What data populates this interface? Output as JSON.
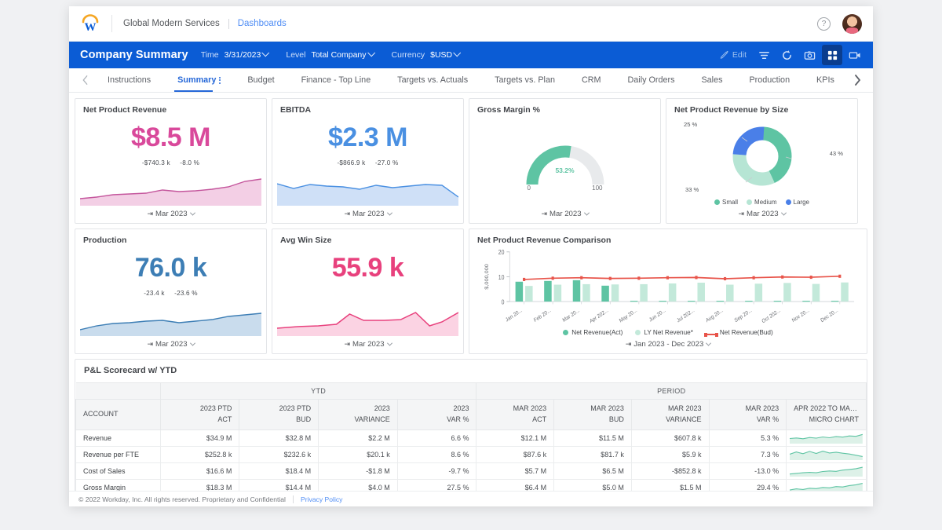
{
  "header": {
    "company": "Global Modern Services",
    "section": "Dashboards",
    "help_icon": "question-mark-icon",
    "logo": "workday-logo"
  },
  "toolbar": {
    "title": "Company Summary",
    "filters": [
      {
        "label": "Time",
        "value": "3/31/2023"
      },
      {
        "label": "Level",
        "value": "Total Company"
      },
      {
        "label": "Currency",
        "value": "$USD"
      }
    ],
    "edit_label": "Edit",
    "icons": [
      "pencil-icon",
      "filter-icon",
      "refresh-icon",
      "camera-icon",
      "grid-icon",
      "presentation-icon"
    ]
  },
  "tabs": [
    {
      "label": "Instructions",
      "active": false
    },
    {
      "label": "Summary",
      "active": true
    },
    {
      "label": "Budget",
      "active": false
    },
    {
      "label": "Finance - Top Line",
      "active": false
    },
    {
      "label": "Targets vs. Actuals",
      "active": false
    },
    {
      "label": "Targets vs. Plan",
      "active": false
    },
    {
      "label": "CRM",
      "active": false
    },
    {
      "label": "Daily Orders",
      "active": false
    },
    {
      "label": "Sales",
      "active": false
    },
    {
      "label": "Production",
      "active": false
    },
    {
      "label": "KPIs",
      "active": false
    }
  ],
  "kpis": [
    {
      "title": "Net Product Revenue",
      "value": "$8.5 M",
      "delta_abs": "-$740.3 k",
      "delta_pct": "-8.0 %",
      "period": "Mar 2023",
      "color": "#d9499b"
    },
    {
      "title": "EBITDA",
      "value": "$2.3 M",
      "delta_abs": "-$866.9 k",
      "delta_pct": "-27.0 %",
      "period": "Mar 2023",
      "color": "#4a90e2"
    },
    {
      "title": "Production",
      "value": "76.0 k",
      "delta_abs": "-23.4 k",
      "delta_pct": "-23.6 %",
      "period": "Mar 2023",
      "color": "#3d7eb5"
    },
    {
      "title": "Avg Win Size",
      "value": "55.9 k",
      "delta_abs": "",
      "delta_pct": "",
      "period": "Mar 2023",
      "color": "#e8417d"
    }
  ],
  "gauge": {
    "title": "Gross Margin %",
    "value_label": "53.2%",
    "value": 53.2,
    "min_label": "0",
    "max_label": "100",
    "period": "Mar 2023",
    "color": "#5ec4a3"
  },
  "donut": {
    "title": "Net Product Revenue by Size",
    "period": "Mar 2023",
    "slices": [
      {
        "label": "Small",
        "pct_label": "43 %",
        "value": 43,
        "color": "#5ec4a3"
      },
      {
        "label": "Medium",
        "pct_label": "33 %",
        "value": 33,
        "color": "#b6e5d4"
      },
      {
        "label": "Large",
        "pct_label": "25 %",
        "value": 25,
        "color": "#4a7fe8"
      }
    ]
  },
  "chart_data": {
    "type": "bar",
    "title": "Net Product Revenue Comparison",
    "xlabel": "",
    "ylabel": "$,000,000",
    "ylim": [
      0,
      20
    ],
    "yticks": [
      0,
      10,
      20
    ],
    "grid": false,
    "legend_position": "bottom",
    "period": "Jan 2023 - Dec 2023",
    "categories": [
      "Jan 20...",
      "Feb 20...",
      "Mar 20...",
      "Apr 202...",
      "May 20...",
      "Jun 20...",
      "Jul 202...",
      "Aug 20...",
      "Sep 20...",
      "Oct 202...",
      "Nov 20...",
      "Dec 20..."
    ],
    "series": [
      {
        "name": "Net Revenue(Act)",
        "type": "bar",
        "color": "#5ec4a3",
        "values": [
          8.0,
          8.3,
          8.6,
          6.4,
          0.3,
          0.3,
          0.3,
          0.3,
          0.3,
          0.3,
          0.3,
          0.3
        ]
      },
      {
        "name": "LY Net Revenue*",
        "type": "bar",
        "color": "#c3e9da",
        "values": [
          6.3,
          6.8,
          7.0,
          6.9,
          7.0,
          7.3,
          7.6,
          6.8,
          7.2,
          7.5,
          7.1,
          7.7
        ]
      },
      {
        "name": "Net Revenue(Bud)",
        "type": "line",
        "color": "#e8544a",
        "values": [
          8.9,
          9.4,
          9.6,
          9.3,
          9.4,
          9.6,
          9.7,
          9.2,
          9.6,
          9.9,
          9.8,
          10.2
        ]
      }
    ]
  },
  "table": {
    "title": "P&L Scorecard w/ YTD",
    "group_headers": [
      {
        "label": "",
        "span": 1
      },
      {
        "label": "YTD",
        "span": 4
      },
      {
        "label": "PERIOD",
        "span": 5
      }
    ],
    "columns": [
      {
        "top": "ACCOUNT",
        "bottom": ""
      },
      {
        "top": "2023 PTD",
        "bottom": "ACT"
      },
      {
        "top": "2023 PTD",
        "bottom": "BUD"
      },
      {
        "top": "2023",
        "bottom": "VARIANCE"
      },
      {
        "top": "2023",
        "bottom": "VAR %"
      },
      {
        "top": "MAR 2023",
        "bottom": "ACT"
      },
      {
        "top": "MAR 2023",
        "bottom": "BUD"
      },
      {
        "top": "MAR 2023",
        "bottom": "VARIANCE"
      },
      {
        "top": "MAR 2023",
        "bottom": "VAR %"
      },
      {
        "top": "APR 2022 TO MAR 2...",
        "bottom": "MICRO CHART"
      }
    ],
    "rows": [
      {
        "account": "Revenue",
        "cells": [
          "$34.9 M",
          "$32.8 M",
          "$2.2 M",
          "6.6 %",
          "$12.1 M",
          "$11.5 M",
          "$607.8 k",
          "5.3 %"
        ],
        "micro": [
          0.42,
          0.48,
          0.4,
          0.52,
          0.46,
          0.58,
          0.5,
          0.62,
          0.56,
          0.68,
          0.64,
          0.82
        ],
        "micro_fill": true
      },
      {
        "account": "Revenue per FTE",
        "cells": [
          "$252.8 k",
          "$232.6 k",
          "$20.1 k",
          "8.6 %",
          "$87.6 k",
          "$81.7 k",
          "$5.9 k",
          "7.3 %"
        ],
        "micro": [
          0.5,
          0.72,
          0.55,
          0.78,
          0.58,
          0.8,
          0.62,
          0.7,
          0.6,
          0.52,
          0.4,
          0.28
        ],
        "micro_fill": true
      },
      {
        "account": "Cost of Sales",
        "cells": [
          "$16.6 M",
          "$18.4 M",
          "-$1.8 M",
          "-9.7 %",
          "$5.7 M",
          "$6.5 M",
          "-$852.8 k",
          "-13.0 %"
        ],
        "micro": [
          0.18,
          0.24,
          0.3,
          0.34,
          0.3,
          0.42,
          0.48,
          0.44,
          0.56,
          0.62,
          0.7,
          0.84
        ],
        "micro_fill": true
      },
      {
        "account": "Gross Margin",
        "cells": [
          "$18.3 M",
          "$14.4 M",
          "$4.0 M",
          "27.5 %",
          "$6.4 M",
          "$5.0 M",
          "$1.5 M",
          "29.4 %"
        ],
        "micro": [
          0.22,
          0.34,
          0.28,
          0.4,
          0.36,
          0.48,
          0.44,
          0.56,
          0.52,
          0.66,
          0.74,
          0.88
        ],
        "micro_fill": true
      }
    ]
  },
  "footer": {
    "copyright": "© 2022 Workday, Inc. All rights reserved. Proprietary and Confidential",
    "privacy": "Privacy Policy"
  }
}
